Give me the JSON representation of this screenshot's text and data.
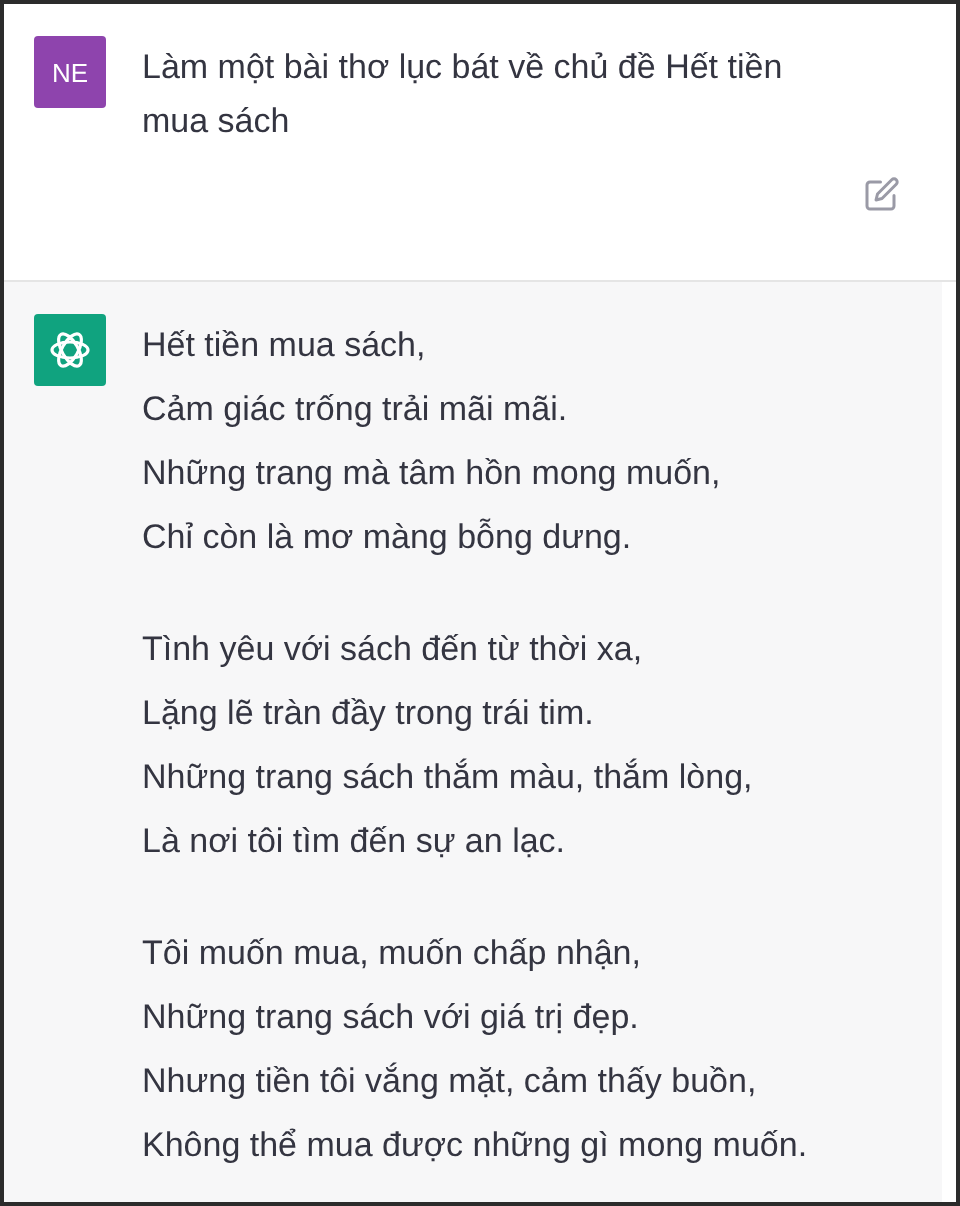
{
  "conversation": [
    {
      "kind": "user",
      "avatar": "NE",
      "text": [
        "Làm một bài thơ lục bát về chủ đề Hết tiền mua sách"
      ]
    },
    {
      "kind": "assistant",
      "stanzas": [
        [
          "Hết tiền mua sách,",
          "Cảm giác trống trải mãi mãi.",
          "Những trang mà tâm hồn mong muốn,",
          "Chỉ còn là mơ màng bỗng dưng."
        ],
        [
          "Tình yêu với sách đến từ thời xa,",
          "Lặng lẽ tràn đầy trong trái tim.",
          "Những trang sách thắm màu, thắm lòng,",
          "Là nơi tôi tìm đến sự an lạc."
        ],
        [
          "Tôi muốn mua, muốn chấp nhận,",
          "Những trang sách với giá trị đẹp.",
          "Nhưng tiền tôi vắng mặt, cảm thấy buồn,",
          "Không thể mua được những gì mong muốn."
        ]
      ]
    }
  ]
}
